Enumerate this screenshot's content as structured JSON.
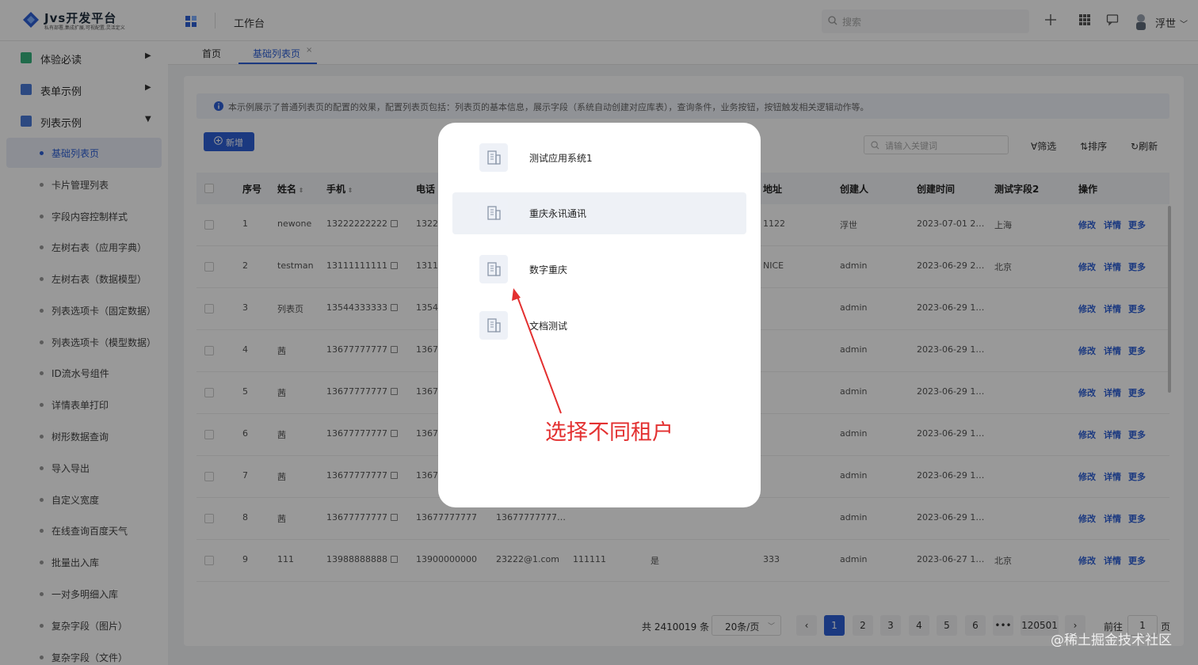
{
  "app": {
    "title": "Jvs开发平台",
    "subtitle": "私有部署,集成扩展,可视配置,灵活定义",
    "workspace": "工作台"
  },
  "header": {
    "search_placeholder": "搜索",
    "user_name": "浮世",
    "icons": [
      "add-icon",
      "grid-icon",
      "message-icon",
      "avatar"
    ]
  },
  "sidebar": {
    "menus": [
      {
        "label": "体验必读",
        "arrow": "▶",
        "color": "#36b37e"
      },
      {
        "label": "表单示例",
        "arrow": "▶",
        "color": "#4a7bd8"
      },
      {
        "label": "列表示例",
        "arrow": "▼",
        "color": "#4a7bd8"
      }
    ],
    "items": [
      "基础列表页",
      "卡片管理列表",
      "字段内容控制样式",
      "左树右表（应用字典）",
      "左树右表（数据模型）",
      "列表选项卡（固定数据）",
      "列表选项卡（模型数据）",
      "ID流水号组件",
      "详情表单打印",
      "树形数据查询",
      "导入导出",
      "自定义宽度",
      "在线查询百度天气",
      "批量出入库",
      "一对多明细入库",
      "复杂字段（图片）",
      "复杂字段（文件）"
    ],
    "active_index": 0
  },
  "tabs": [
    {
      "label": "首页"
    },
    {
      "label": "基础列表页",
      "close": "×"
    }
  ],
  "notice": "本示例展示了普通列表页的配置的效果，配置列表页包括：列表页的基本信息，展示字段（系统自动创建对应库表），查询条件，业务按钮，按钮触发相关逻辑动作等。",
  "toolbar": {
    "add": "新增",
    "keyword_placeholder": "请输入关键词",
    "filter": "筛选",
    "sort": "排序",
    "refresh": "刷新"
  },
  "table": {
    "columns": [
      "序号",
      "姓名",
      "手机",
      "电话",
      "地址",
      "创建人",
      "创建时间",
      "测试字段2",
      "操作"
    ],
    "actions": [
      "修改",
      "详情",
      "更多"
    ],
    "rows": [
      {
        "no": "1",
        "name": "newone",
        "mobile": "13222222222",
        "phone": "13222",
        "email": "",
        "c6": "",
        "c7": "",
        "addr": "1122",
        "creator": "浮世",
        "time": "2023-07-01 2…",
        "f2": "上海"
      },
      {
        "no": "2",
        "name": "testman",
        "mobile": "13111111111",
        "phone": "13111",
        "email": "",
        "c6": "",
        "c7": "",
        "addr": "NICE",
        "creator": "admin",
        "time": "2023-06-29 2…",
        "f2": "北京"
      },
      {
        "no": "3",
        "name": "列表页",
        "mobile": "13544333333",
        "phone": "13544",
        "email": "",
        "c6": "",
        "c7": "",
        "addr": "",
        "creator": "admin",
        "time": "2023-06-29 1…",
        "f2": ""
      },
      {
        "no": "4",
        "name": "茜",
        "mobile": "13677777777",
        "phone": "13677",
        "email": "",
        "c6": "",
        "c7": "",
        "addr": "",
        "creator": "admin",
        "time": "2023-06-29 1…",
        "f2": ""
      },
      {
        "no": "5",
        "name": "茜",
        "mobile": "13677777777",
        "phone": "13677",
        "email": "",
        "c6": "",
        "c7": "",
        "addr": "",
        "creator": "admin",
        "time": "2023-06-29 1…",
        "f2": ""
      },
      {
        "no": "6",
        "name": "茜",
        "mobile": "13677777777",
        "phone": "13677",
        "email": "",
        "c6": "",
        "c7": "",
        "addr": "",
        "creator": "admin",
        "time": "2023-06-29 1…",
        "f2": ""
      },
      {
        "no": "7",
        "name": "茜",
        "mobile": "13677777777",
        "phone": "13677",
        "email": "",
        "c6": "",
        "c7": "",
        "addr": "",
        "creator": "admin",
        "time": "2023-06-29 1…",
        "f2": ""
      },
      {
        "no": "8",
        "name": "茜",
        "mobile": "13677777777",
        "phone": "13677777777",
        "email": "13677777777…",
        "c6": "",
        "c7": "",
        "addr": "",
        "creator": "admin",
        "time": "2023-06-29 1…",
        "f2": ""
      },
      {
        "no": "9",
        "name": "111",
        "mobile": "13988888888",
        "phone": "13900000000",
        "email": "23222@1.com",
        "c6": "111111",
        "c7": "是",
        "addr": "333",
        "creator": "admin",
        "time": "2023-06-27 1…",
        "f2": "北京"
      }
    ]
  },
  "pagination": {
    "total": "共 2410019 条",
    "page_size": "20条/页",
    "pages": [
      "1",
      "2",
      "3",
      "4",
      "5",
      "6",
      "•••",
      "120501"
    ],
    "current": "1",
    "goto_label": "前往",
    "goto_value": "1",
    "page_unit": "页"
  },
  "modal": {
    "options": [
      {
        "label": "测试应用系统1"
      },
      {
        "label": "重庆永讯通讯"
      },
      {
        "label": "数字重庆"
      },
      {
        "label": "文档测试"
      }
    ],
    "hover_index": 1
  },
  "annotation": {
    "text": "选择不同租户",
    "color": "#e33030"
  },
  "watermark": "@稀土掘金技术社区"
}
